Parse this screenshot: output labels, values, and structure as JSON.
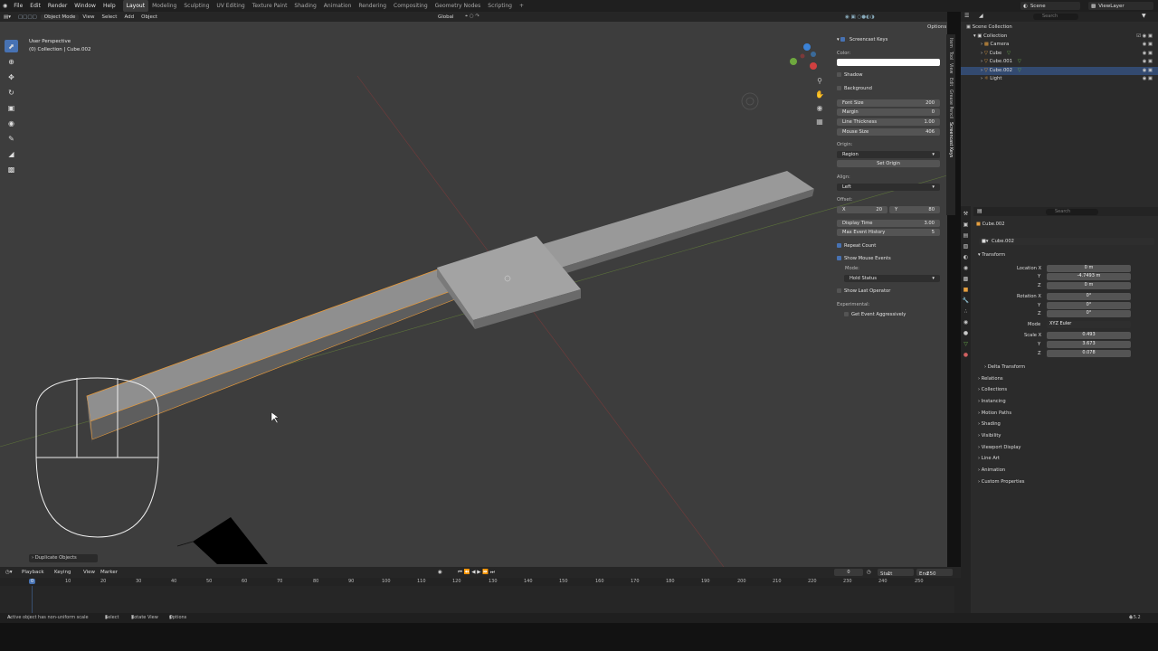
{
  "menu": {
    "items": [
      "File",
      "Edit",
      "Render",
      "Window",
      "Help"
    ],
    "workspaces": [
      "Layout",
      "Modeling",
      "Sculpting",
      "UV Editing",
      "Texture Paint",
      "Shading",
      "Animation",
      "Rendering",
      "Compositing",
      "Geometry Nodes",
      "Scripting"
    ],
    "active_workspace": "Layout",
    "add_tab": "+",
    "scene": "Scene",
    "view_layer": "ViewLayer"
  },
  "viewport_header": {
    "mode": "Object Mode",
    "menus": [
      "View",
      "Select",
      "Add",
      "Object"
    ],
    "orientation": "Global",
    "options": "Options"
  },
  "viewport": {
    "perspective": "User Perspective",
    "collection_info": "(0) Collection | Cube.002",
    "operator_panel": "Duplicate Objects"
  },
  "screencast": {
    "title": "Screencast Keys",
    "color_label": "Color:",
    "shadow": "Shadow",
    "background": "Background",
    "font_size_label": "Font Size",
    "font_size": "200",
    "margin_label": "Margin",
    "margin": "0",
    "line_thickness_label": "Line Thickness",
    "line_thickness": "1.00",
    "mouse_size_label": "Mouse Size",
    "mouse_size": "406",
    "origin_label": "Origin:",
    "origin": "Region",
    "set_origin": "Set Origin",
    "align_label": "Align:",
    "align": "Left",
    "offset_label": "Offset:",
    "offset_x_label": "X",
    "offset_x": "20",
    "offset_y_label": "Y",
    "offset_y": "80",
    "display_time_label": "Display Time",
    "display_time": "3.00",
    "max_history_label": "Max Event History",
    "max_history": "5",
    "repeat_count": "Repeat Count",
    "show_mouse_events": "Show Mouse Events",
    "mode_label": "Mode:",
    "mode": "Hold Status",
    "show_last_operator": "Show Last Operator",
    "experimental_label": "Experimental:",
    "get_event_aggressively": "Get Event Aggressively"
  },
  "npanel_tabs": [
    "Item",
    "Tool",
    "View",
    "Edit",
    "Grease Pencil",
    "Screencast Keys"
  ],
  "outliner": {
    "search_placeholder": "Search",
    "root": "Scene Collection",
    "items": [
      {
        "label": "Collection",
        "indent": 1,
        "selected": false,
        "icon": "collection-icon"
      },
      {
        "label": "Camera",
        "indent": 2,
        "selected": false,
        "icon": "camera-icon"
      },
      {
        "label": "Cube",
        "indent": 2,
        "selected": false,
        "icon": "mesh-icon"
      },
      {
        "label": "Cube.001",
        "indent": 2,
        "selected": false,
        "icon": "mesh-icon"
      },
      {
        "label": "Cube.002",
        "indent": 2,
        "selected": true,
        "icon": "mesh-icon"
      },
      {
        "label": "Light",
        "indent": 2,
        "selected": false,
        "icon": "light-icon"
      }
    ]
  },
  "properties": {
    "search_placeholder": "Search",
    "object_name": "Cube.002",
    "data_name": "Cube.002",
    "transform_label": "Transform",
    "location_x_label": "Location X",
    "location_x": "0 m",
    "location_y_label": "Y",
    "location_y": "-4.7493 m",
    "location_z_label": "Z",
    "location_z": "0 m",
    "rotation_x_label": "Rotation X",
    "rotation_x": "0°",
    "rotation_y_label": "Y",
    "rotation_y": "0°",
    "rotation_z_label": "Z",
    "rotation_z": "0°",
    "mode_label": "Mode",
    "mode": "XYZ Euler",
    "scale_x_label": "Scale X",
    "scale_x": "0.493",
    "scale_y_label": "Y",
    "scale_y": "3.673",
    "scale_z_label": "Z",
    "scale_z": "0.078",
    "delta_transform": "Delta Transform",
    "sections": [
      "Relations",
      "Collections",
      "Instancing",
      "Motion Paths",
      "Shading",
      "Visibility",
      "Viewport Display",
      "Line Art",
      "Animation",
      "Custom Properties"
    ]
  },
  "timeline": {
    "menus": [
      "Playback",
      "Keying",
      "View",
      "Marker"
    ],
    "current_frame": "0",
    "start_label": "Start",
    "start": "1",
    "end_label": "End",
    "end": "250",
    "frames": [
      "0",
      "10",
      "20",
      "30",
      "40",
      "50",
      "60",
      "70",
      "80",
      "90",
      "100",
      "110",
      "120",
      "130",
      "140",
      "150",
      "160",
      "170",
      "180",
      "190",
      "200",
      "210",
      "220",
      "230",
      "240",
      "250"
    ]
  },
  "statusbar": {
    "message": "Active object has non-uniform scale",
    "select": "Select",
    "rotate_view": "Rotate View",
    "options": "Options",
    "version": "4.5.2"
  },
  "colors": {
    "accent": "#4772b3",
    "selection_outline": "#e89a3a",
    "viewport_bg": "#3d3d3d"
  }
}
